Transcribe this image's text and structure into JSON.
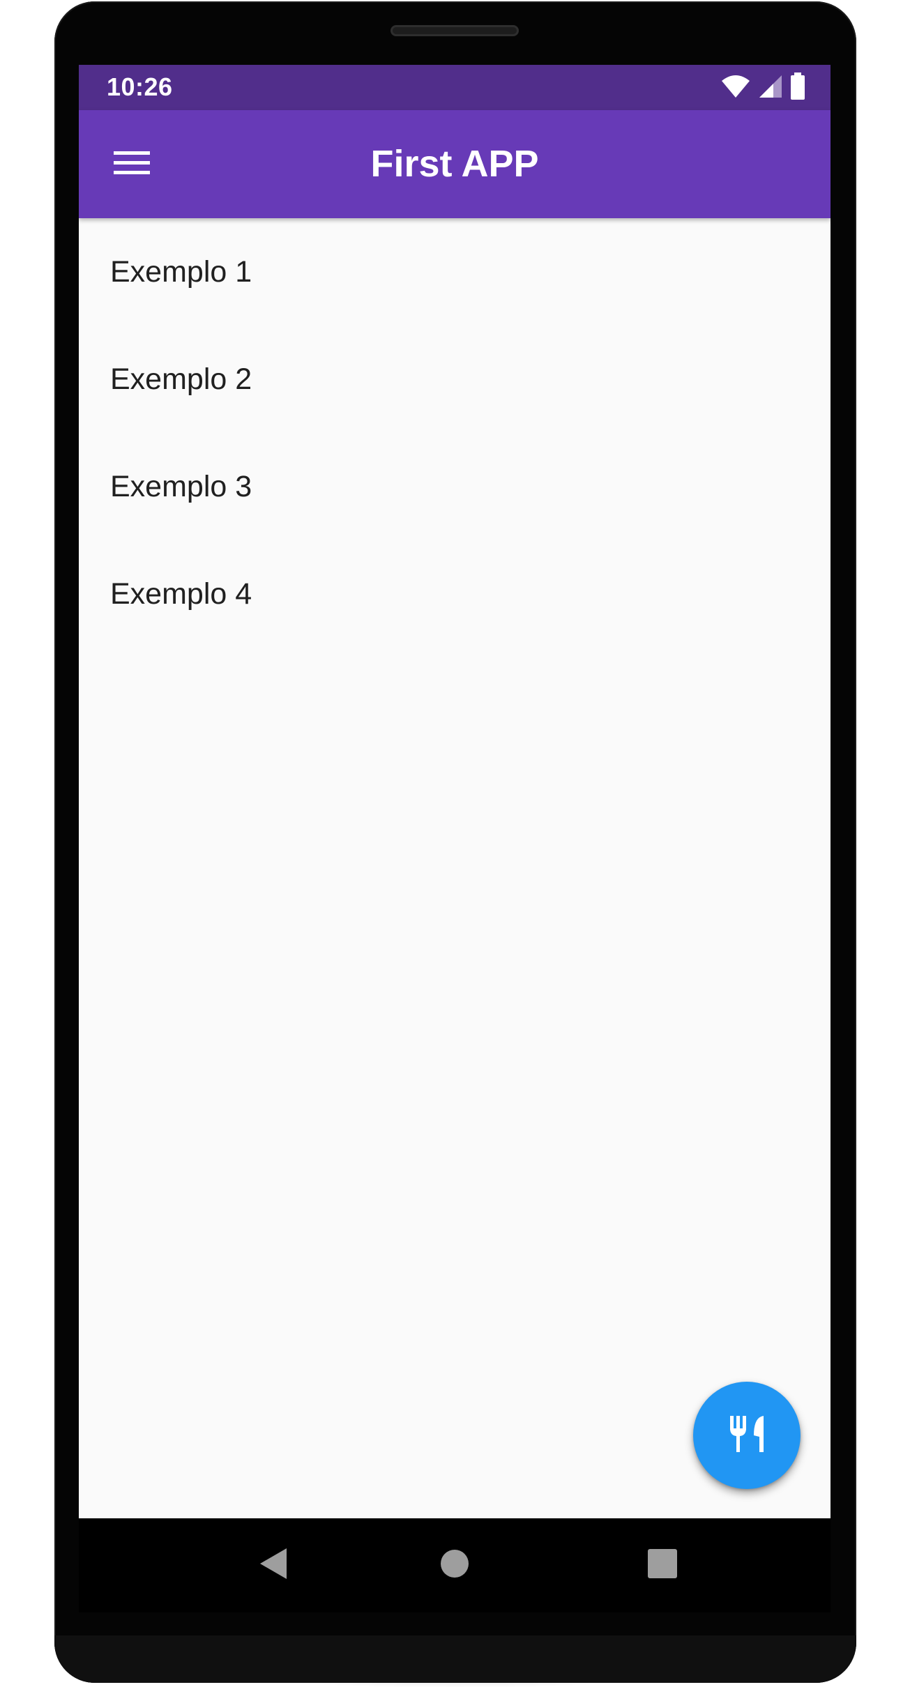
{
  "status_bar": {
    "time": "10:26",
    "icons": [
      "wifi-icon",
      "cellular-signal-icon",
      "battery-icon"
    ],
    "color": "#512e8b"
  },
  "app_bar": {
    "title": "First APP",
    "menu_icon": "hamburger-menu-icon",
    "color": "#673ab7"
  },
  "list": {
    "items": [
      {
        "label": "Exemplo 1"
      },
      {
        "label": "Exemplo 2"
      },
      {
        "label": "Exemplo 3"
      },
      {
        "label": "Exemplo 4"
      }
    ]
  },
  "fab": {
    "icon": "restaurant-icon",
    "color": "#2196f3"
  },
  "nav_bar": {
    "buttons": [
      "back-icon",
      "home-icon",
      "recents-icon"
    ]
  },
  "colors": {
    "background": "#fafafa",
    "text": "#202020"
  }
}
